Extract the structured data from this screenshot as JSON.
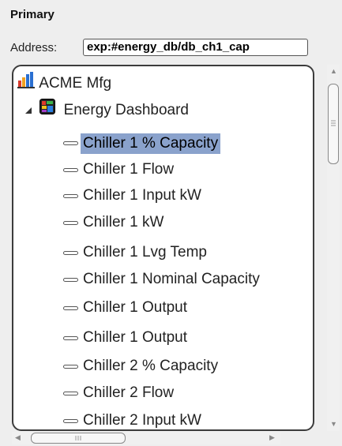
{
  "panel": {
    "title": "Primary",
    "address_label": "Address:",
    "address_value": "exp:#energy_db/db_ch1_cap"
  },
  "tree": {
    "root": {
      "label": "ACME Mfg",
      "icon": "building-chart-icon"
    },
    "folder": {
      "label": "Energy Dashboard",
      "icon": "dashboard-icon",
      "expanded": true
    },
    "items": [
      "Chiller 1 % Capacity",
      "Chiller 1 Flow",
      "Chiller 1 Input kW",
      "Chiller 1 kW",
      "Chiller 1 Lvg Temp",
      "Chiller 1 Nominal Capacity",
      "Chiller 1 Output",
      "Chiller 1 Output",
      "Chiller 2 % Capacity",
      "Chiller 2 Flow",
      "Chiller 2 Input kW"
    ],
    "selected_item": "Chiller 1 % Capacity"
  },
  "colors": {
    "selection": "#8aa2cc",
    "frame_border": "#3c3c3c"
  }
}
